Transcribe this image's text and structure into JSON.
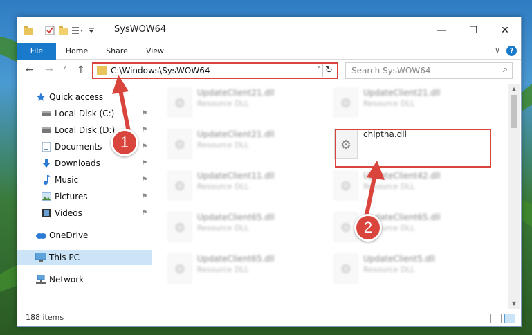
{
  "titlebar": {
    "title": "SysWOW64",
    "qat_icons": [
      "folder-icon",
      "properties-icon",
      "new-folder-icon",
      "customize-icon"
    ],
    "controls": {
      "minimize": "—",
      "maximize": "☐",
      "close": "✕"
    }
  },
  "ribbon": {
    "tabs": [
      "File",
      "Home",
      "Share",
      "View"
    ],
    "expand": "∨",
    "help": "?"
  },
  "nav": {
    "back": "←",
    "forward": "→",
    "recent": "˅",
    "up": "↑",
    "address": "C:\\Windows\\SysWOW64",
    "address_dropdown": "˅",
    "refresh": "↻",
    "search_placeholder": "Search SysWOW64",
    "search_icon": "⌕"
  },
  "sidebar": {
    "items": [
      {
        "label": "Quick access",
        "icon": "star-icon",
        "pinned": false
      },
      {
        "label": "Local Disk (C:)",
        "icon": "drive-icon",
        "pinned": true
      },
      {
        "label": "Local Disk (D:)",
        "icon": "drive-icon",
        "pinned": true
      },
      {
        "label": "Documents",
        "icon": "documents-icon",
        "pinned": true
      },
      {
        "label": "Downloads",
        "icon": "download-icon",
        "pinned": true
      },
      {
        "label": "Music",
        "icon": "music-icon",
        "pinned": true
      },
      {
        "label": "Pictures",
        "icon": "pictures-icon",
        "pinned": true
      },
      {
        "label": "Videos",
        "icon": "videos-icon",
        "pinned": true
      },
      {
        "label": "OneDrive",
        "icon": "cloud-icon",
        "pinned": false
      },
      {
        "label": "This PC",
        "icon": "computer-icon",
        "pinned": false,
        "selected": true
      },
      {
        "label": "Network",
        "icon": "network-icon",
        "pinned": false
      }
    ],
    "pin_glyph": "⚑"
  },
  "files": [
    {
      "name": "UpdateClient21.dll",
      "type": "Resource DLL",
      "blurred": true
    },
    {
      "name": "UpdateClient21.dll",
      "type": "Resource DLL",
      "blurred": true
    },
    {
      "name": "UpdateClient21.dll",
      "type": "Resource DLL",
      "blurred": true
    },
    {
      "name": "chiptha.dll",
      "type": "",
      "blurred": false
    },
    {
      "name": "UpdateClient11.dll",
      "type": "Resource DLL",
      "blurred": true
    },
    {
      "name": "UpdateClient42.dll",
      "type": "Resource DLL",
      "blurred": true
    },
    {
      "name": "UpdateClient65.dll",
      "type": "Resource DLL",
      "blurred": true
    },
    {
      "name": "UpdateClient65.dll",
      "type": "Resource DLL",
      "blurred": true
    },
    {
      "name": "UpdateClient65.dll",
      "type": "Resource DLL",
      "blurred": true
    },
    {
      "name": "UpdateClient5.dll",
      "type": "Resource DLL",
      "blurred": true
    }
  ],
  "status": {
    "item_count": "188 items"
  },
  "annotations": [
    {
      "label": "1"
    },
    {
      "label": "2"
    }
  ],
  "colors": {
    "accent": "#1979ca",
    "annotation_red": "#d9453c",
    "selected": "#cce4f7"
  }
}
